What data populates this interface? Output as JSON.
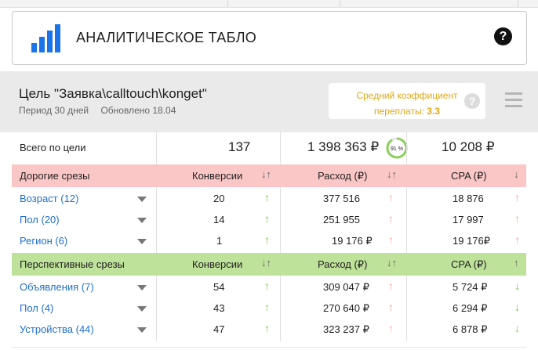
{
  "app": {
    "title": "АНАЛИТИЧЕСКОЕ ТАБЛО",
    "help_label": "?",
    "icon": "bar-chart-logo-icon"
  },
  "goal": {
    "title": "Цель \"Заявка\\calltouch\\konget\"",
    "period": "Период 30 дней",
    "updated": "Обновлено 18.04",
    "coef_line1": "Средний коэффициент",
    "coef_line2": "переплаты:",
    "coef_value": "3.3",
    "coef_help": "?",
    "menu_icon": "hamburger-menu-icon"
  },
  "totals": {
    "label": "Всего по цели",
    "conversions": "137",
    "spend": "1 398 363 ₽",
    "spend_share": "91 %",
    "spend_share_fraction": 0.91,
    "cpa": "10 208 ₽"
  },
  "sections": [
    {
      "name": "Дорогие срезы",
      "color": "#fbc6c6",
      "columns": [
        "Конверсии",
        "Расход (₽)",
        "CPA (₽)"
      ],
      "sort_icons": [
        "↓↑",
        "↓↑",
        "↓"
      ],
      "rows": [
        {
          "name": "Возраст (12)",
          "conversions": "20",
          "conv_trend": "↑",
          "spend": "377 516",
          "spend_trend": "↑",
          "cpa": "18 876",
          "cpa_trend": "↑"
        },
        {
          "name": "Пол (20)",
          "conversions": "14",
          "conv_trend": "↑",
          "spend": "251 955",
          "spend_trend": "↑",
          "cpa": "17 997",
          "cpa_trend": "↑"
        },
        {
          "name": "Регион (6)",
          "conversions": "1",
          "conv_trend": "↑",
          "spend": "19 176 ₽",
          "spend_trend": "↑",
          "cpa": "19 176₽",
          "cpa_trend": "↑"
        }
      ]
    },
    {
      "name": "Перспективные срезы",
      "color": "#bfe29a",
      "columns": [
        "Конверсии",
        "Расход (₽)",
        "CPA (₽)"
      ],
      "sort_icons": [
        "↓↑",
        "↓↑",
        "↑"
      ],
      "rows": [
        {
          "name": "Объявления (7)",
          "conversions": "54",
          "conv_trend": "↑",
          "spend": "309 047 ₽",
          "spend_trend": "↑",
          "cpa": "5 724 ₽",
          "cpa_trend": "↓"
        },
        {
          "name": "Пол (4)",
          "conversions": "43",
          "conv_trend": "↑",
          "spend": "270 640 ₽",
          "spend_trend": "↑",
          "cpa": "6 294 ₽",
          "cpa_trend": "↓"
        },
        {
          "name": "Устройства (44)",
          "conversions": "47",
          "conv_trend": "↑",
          "spend": "323 237 ₽",
          "spend_trend": "↑",
          "cpa": "6 878 ₽",
          "cpa_trend": "↓"
        }
      ]
    }
  ],
  "colors": {
    "link": "#1e6fd0",
    "trend_green": "#7cc44a",
    "trend_pink": "#f4a5a5",
    "coef_text": "#e0a817",
    "ring": "#8ccf5a"
  }
}
